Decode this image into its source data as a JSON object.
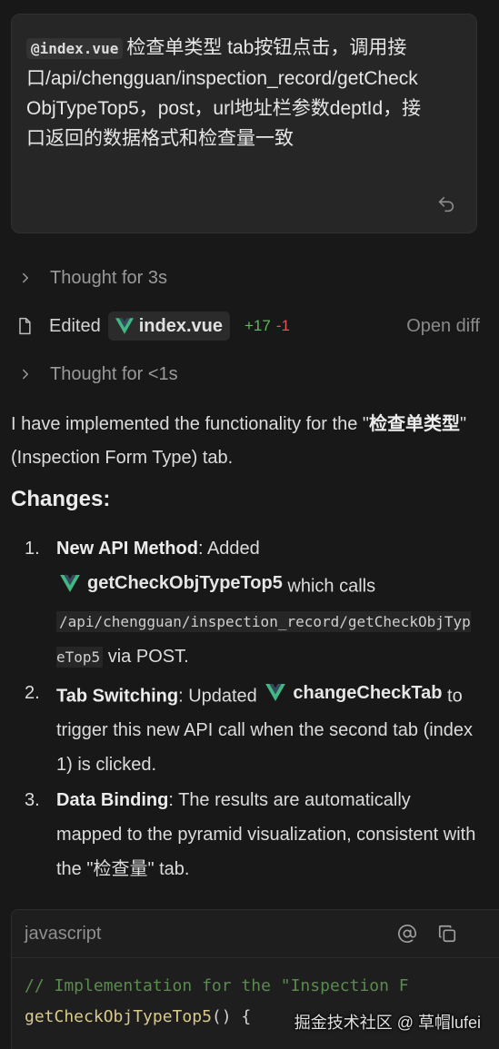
{
  "prompt": {
    "file_ref": "@index.vue",
    "text": "检查单类型 tab按钮点击，调用接口/api/chengguan/inspection_record/getCheckObjTypeTop5，post，url地址栏参数deptId，接口返回的数据格式和检查量一致"
  },
  "thoughts": [
    {
      "label": "Thought for 3s"
    },
    {
      "label": "Thought for <1s"
    }
  ],
  "edit": {
    "label": "Edited",
    "file": "index.vue",
    "added": "+17",
    "removed": "-1",
    "open_diff": "Open diff"
  },
  "response": {
    "intro_pre": "I have implemented the functionality for the \"",
    "intro_bold": "检查单类型",
    "intro_post": "\" (Inspection Form Type) tab.",
    "changes_heading": "Changes:",
    "items": [
      {
        "num": "1.",
        "title": "New API Method",
        "pre": ": Added ",
        "symbol": "getCheckObjTypeTop5",
        "mid": " which calls ",
        "code": "/api/chengguan/inspection_record/getCheckObjTypeTop5",
        "post": " via POST."
      },
      {
        "num": "2.",
        "title": "Tab Switching",
        "pre": ": Updated ",
        "symbol": "changeCheckTab",
        "post": " to trigger this new API call when the second tab (index 1) is clicked."
      },
      {
        "num": "3.",
        "title": "Data Binding",
        "post": ": The results are automatically mapped to the pyramid visualization, consistent with the \"检查量\" tab."
      }
    ]
  },
  "code_block": {
    "language": "javascript",
    "line1": "// Implementation for the \"Inspection F",
    "line2_fn": "getCheckObjTypeTop5",
    "line2_rest": "() {"
  },
  "watermark": "掘金技术社区 @ 草帽lufei",
  "colors": {
    "background": "#181818",
    "vue_green": "#41b883",
    "added": "#5fb85f",
    "removed": "#e05555"
  }
}
